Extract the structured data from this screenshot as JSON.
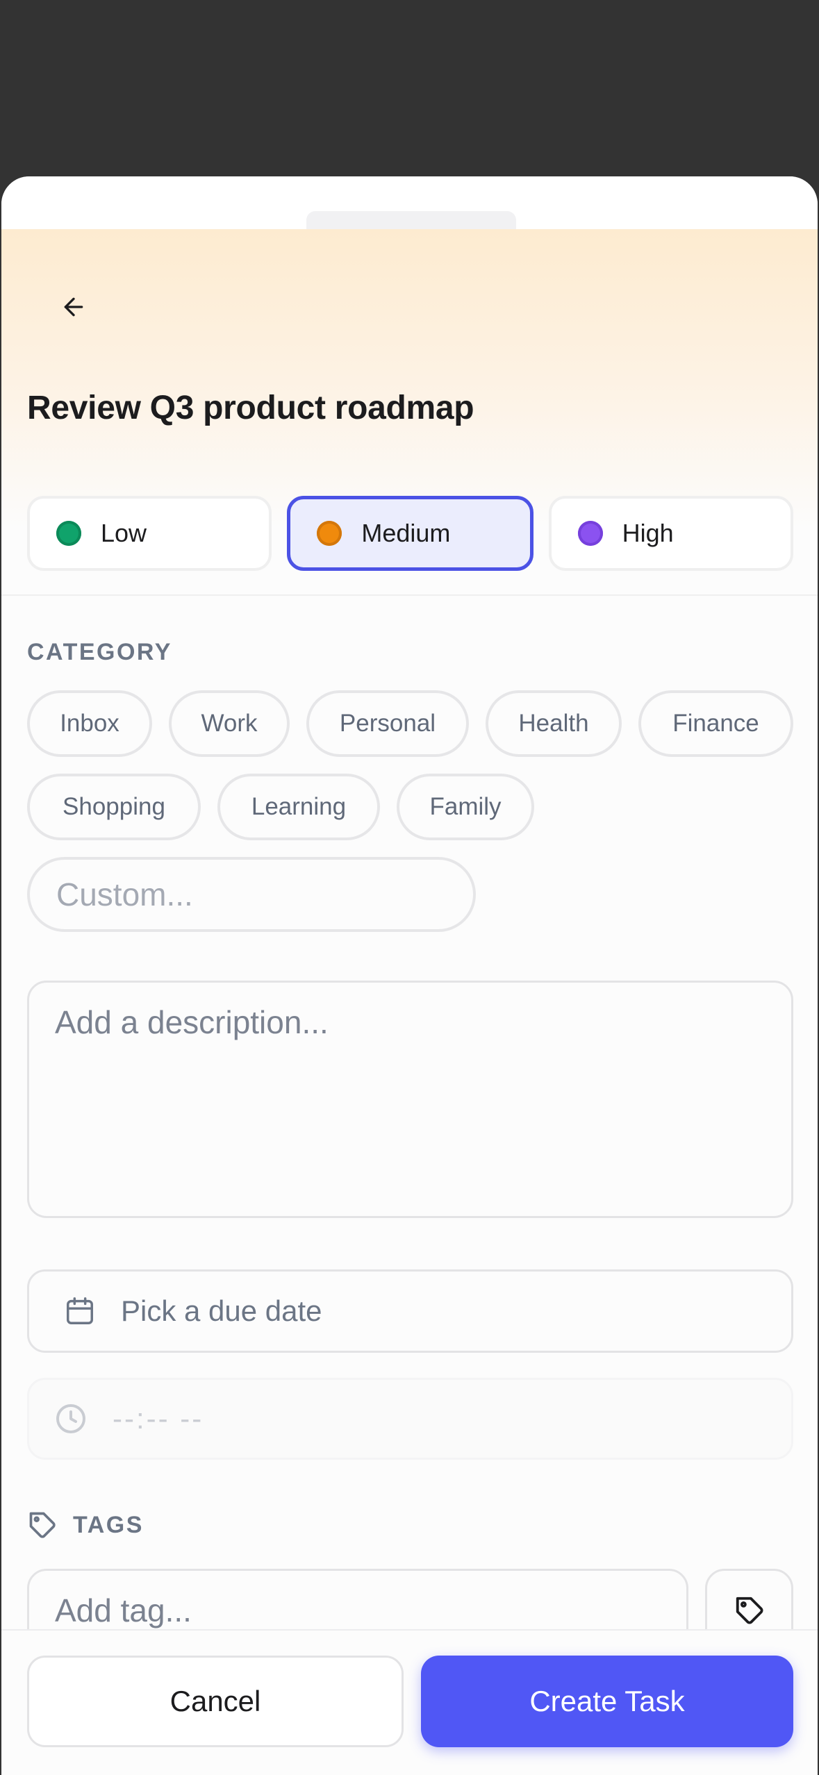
{
  "header": {
    "title": "Review Q3 product roadmap",
    "back_icon": "arrow-left-icon"
  },
  "priority": {
    "options": [
      {
        "label": "Low",
        "color": "#10a36b"
      },
      {
        "label": "Medium",
        "color": "#f08a0c"
      },
      {
        "label": "High",
        "color": "#8b52f0"
      }
    ],
    "selected": "Medium"
  },
  "category": {
    "label": "CATEGORY",
    "chips": [
      "Inbox",
      "Work",
      "Personal",
      "Health",
      "Finance",
      "Shopping",
      "Learning",
      "Family"
    ],
    "custom_placeholder": "Custom..."
  },
  "description": {
    "placeholder": "Add a description..."
  },
  "due": {
    "placeholder": "Pick a due date",
    "icon": "calendar-icon"
  },
  "time": {
    "placeholder": "--:-- --",
    "icon": "clock-icon"
  },
  "tags": {
    "label": "TAGS",
    "icon": "tag-icon",
    "placeholder": "Add tag..."
  },
  "footer": {
    "cancel_label": "Cancel",
    "create_label": "Create Task"
  },
  "colors": {
    "accent": "#5057f5",
    "selected_bg": "#ebedfd",
    "selected_border": "#4b52e5"
  }
}
